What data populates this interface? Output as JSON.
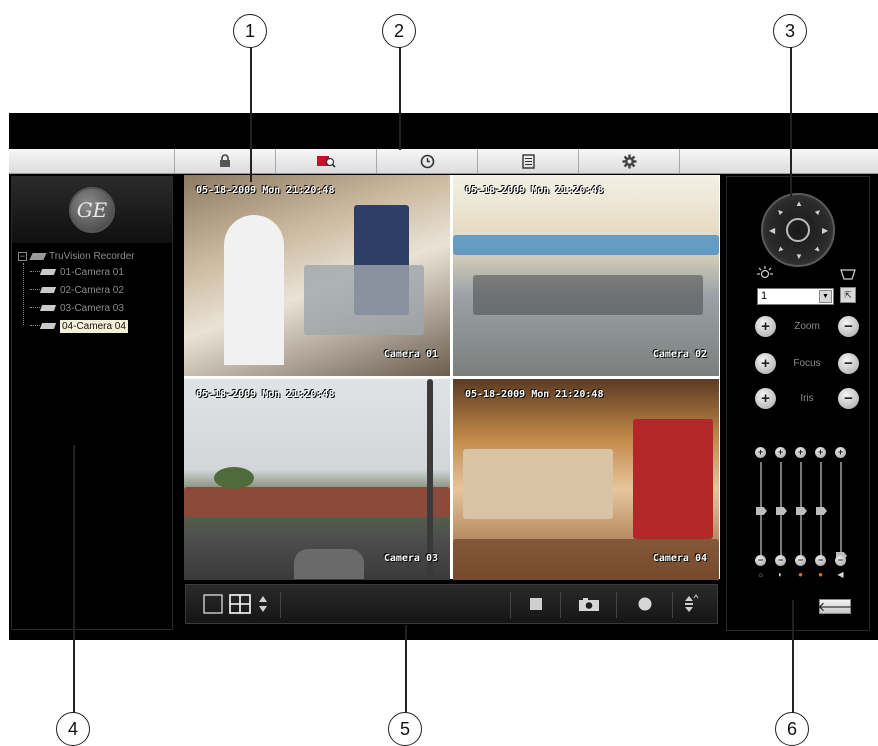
{
  "callouts": [
    "1",
    "2",
    "3",
    "4",
    "5",
    "6"
  ],
  "toolbar": {
    "buttons": [
      {
        "name": "lock",
        "icon": "lock-icon"
      },
      {
        "name": "search",
        "icon": "search-icon"
      },
      {
        "name": "schedule",
        "icon": "clock-icon"
      },
      {
        "name": "log",
        "icon": "log-icon"
      },
      {
        "name": "settings",
        "icon": "gear-icon"
      }
    ]
  },
  "left_panel": {
    "logo": "GE",
    "tree": {
      "root_label": "TruVision Recorder",
      "items": [
        {
          "label": "01-Camera 01",
          "selected": false
        },
        {
          "label": "02-Camera 02",
          "selected": false
        },
        {
          "label": "03-Camera 03",
          "selected": false
        },
        {
          "label": "04-Camera 04",
          "selected": true
        }
      ]
    }
  },
  "video_grid": {
    "tiles": [
      {
        "timestamp": "05-18-2009 Mon 21:20:48",
        "camera": "Camera 01"
      },
      {
        "timestamp": "05-18-2009 Mon 21:20:48",
        "camera": "Camera 02"
      },
      {
        "timestamp": "05-18-2009 Mon 21:20:48",
        "camera": "Camera 03"
      },
      {
        "timestamp": "05-18-2009 Mon 21:20:48",
        "camera": "Camera 04"
      }
    ]
  },
  "video_controls": {
    "icons": [
      "single-view-icon",
      "quad-view-icon",
      "layout-switch-icon",
      "stop-icon",
      "snapshot-icon",
      "record-icon",
      "volume-adjust-icon"
    ]
  },
  "ptz": {
    "preset_value": "1",
    "controls": [
      {
        "label": "Zoom"
      },
      {
        "label": "Focus"
      },
      {
        "label": "Iris"
      }
    ],
    "image_sliders": {
      "icons": [
        "brightness-icon",
        "contrast-icon",
        "saturation-icon",
        "hue-icon",
        "volume-icon"
      ],
      "levels": [
        0.5,
        0.5,
        0.5,
        0.5,
        0.0
      ]
    }
  },
  "colors": {
    "background": "#000000",
    "toolbar": "#e6e6e6",
    "search_accent": "#c8102e",
    "selected_item_bg": "#f3f0d8"
  }
}
